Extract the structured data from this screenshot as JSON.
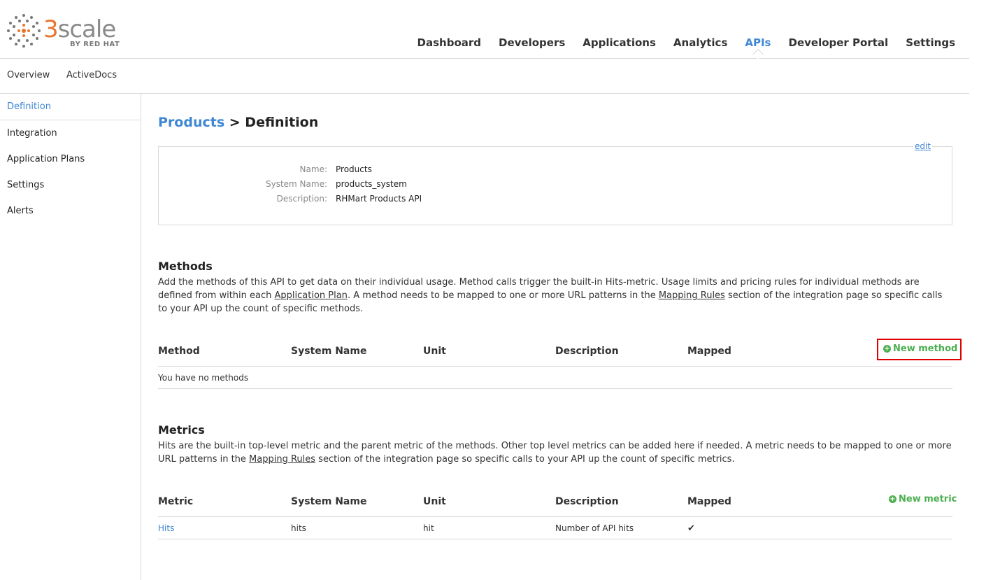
{
  "brand": {
    "logo_text_accent": "3",
    "logo_text": "scale",
    "logo_sub": "BY RED HAT",
    "accent_color": "#3f87d4",
    "brand_color": "#e9742d"
  },
  "topnav": {
    "items": [
      {
        "label": "Dashboard"
      },
      {
        "label": "Developers"
      },
      {
        "label": "Applications"
      },
      {
        "label": "Analytics"
      },
      {
        "label": "APIs",
        "active": true
      },
      {
        "label": "Developer Portal"
      },
      {
        "label": "Settings"
      }
    ]
  },
  "subnav": {
    "items": [
      {
        "label": "Overview"
      },
      {
        "label": "ActiveDocs"
      }
    ]
  },
  "sidebar": {
    "items": [
      {
        "label": "Definition",
        "active": true
      },
      {
        "label": "Integration"
      },
      {
        "label": "Application Plans"
      },
      {
        "label": "Settings"
      },
      {
        "label": "Alerts"
      }
    ]
  },
  "page": {
    "breadcrumb": "Products",
    "separator": " > ",
    "title": "Definition"
  },
  "definition": {
    "edit_label": "edit",
    "fields": [
      {
        "label": "Name:",
        "value": "Products"
      },
      {
        "label": "System Name:",
        "value": "products_system"
      },
      {
        "label": "Description:",
        "value": "RHMart Products API"
      }
    ]
  },
  "methods": {
    "title": "Methods",
    "desc_1": "Add the methods of this API to get data on their individual usage. Method calls trigger the built-in Hits-metric. Usage limits and pricing rules for individual methods are defined from within each ",
    "desc_link_1": "Application Plan",
    "desc_2": ". A method needs to be mapped to one or more URL patterns in the ",
    "desc_link_2": "Mapping Rules",
    "desc_3": " section of the integration page so specific calls to your API up the count of specific methods.",
    "columns": [
      "Method",
      "System Name",
      "Unit",
      "Description",
      "Mapped"
    ],
    "new_label": "New method",
    "empty_text": "You have no methods"
  },
  "metrics": {
    "title": "Metrics",
    "desc_1": "Hits are the built-in top-level metric and the parent metric of the methods. Other top level metrics can be added here if needed. A metric needs to be mapped to one or more URL patterns in the ",
    "desc_link_1": "Mapping Rules",
    "desc_2": " section of the integration page so specific calls to your API up the count of specific metrics.",
    "columns": [
      "Metric",
      "System Name",
      "Unit",
      "Description",
      "Mapped"
    ],
    "new_label": "New metric",
    "rows": [
      {
        "metric": "Hits",
        "system_name": "hits",
        "unit": "hit",
        "description": "Number of API hits",
        "mapped": "✔"
      }
    ]
  }
}
